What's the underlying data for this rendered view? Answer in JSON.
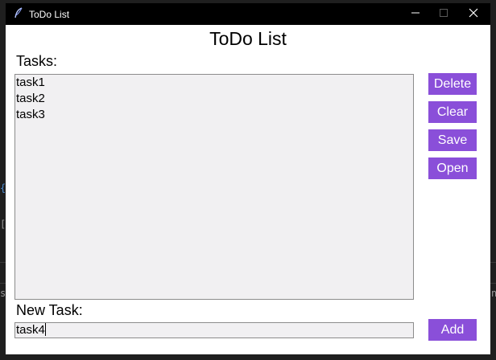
{
  "window": {
    "title": "ToDo List"
  },
  "app": {
    "heading": "ToDo List",
    "tasks_label": "Tasks:",
    "new_task_label": "New Task:"
  },
  "tasks": [
    "task1",
    "task2",
    "task3"
  ],
  "new_task_input": {
    "value": "task4"
  },
  "buttons": {
    "delete": "Delete",
    "clear": "Clear",
    "save": "Save",
    "open": "Open",
    "add": "Add"
  },
  "colors": {
    "button_bg": "#8a4fd9",
    "titlebar_bg": "#000000",
    "list_bg": "#f1f0f2"
  },
  "icons": {
    "app": "feather-icon",
    "minimize": "minimize-icon",
    "maximize": "maximize-icon",
    "close": "close-icon"
  }
}
